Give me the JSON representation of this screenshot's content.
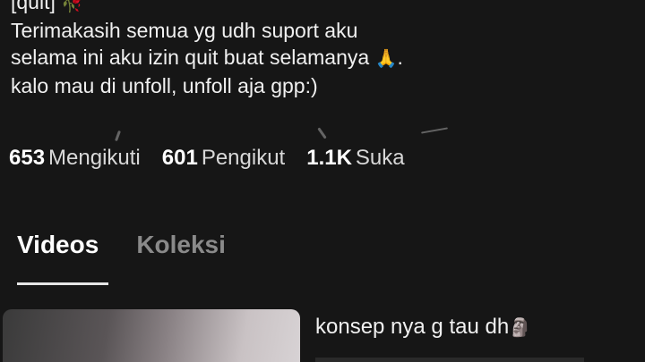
{
  "bio": {
    "line1": "[quit]",
    "line1_icon": "rose-icon",
    "line2": "Terimakasih semua yg udh suport aku",
    "line3": "selama ini aku izin quit buat selamanya",
    "line3_icon": "praying-hands-icon",
    "line3_suffix": ".",
    "line4": "kalo mau di unfoll, unfoll aja gpp:)"
  },
  "stats": [
    {
      "count": "653",
      "label": "Mengikuti"
    },
    {
      "count": "601",
      "label": "Pengikut"
    },
    {
      "count": "1.1K",
      "label": "Suka"
    }
  ],
  "tabs": [
    {
      "label": "Videos",
      "active": true
    },
    {
      "label": "Koleksi",
      "active": false
    }
  ],
  "video": {
    "title": "konsep nya g tau dh",
    "title_icon": "moai-icon"
  },
  "colors": {
    "background": "#161616",
    "text": "#f0f0f0",
    "inactive_tab": "#8a8a8a"
  }
}
